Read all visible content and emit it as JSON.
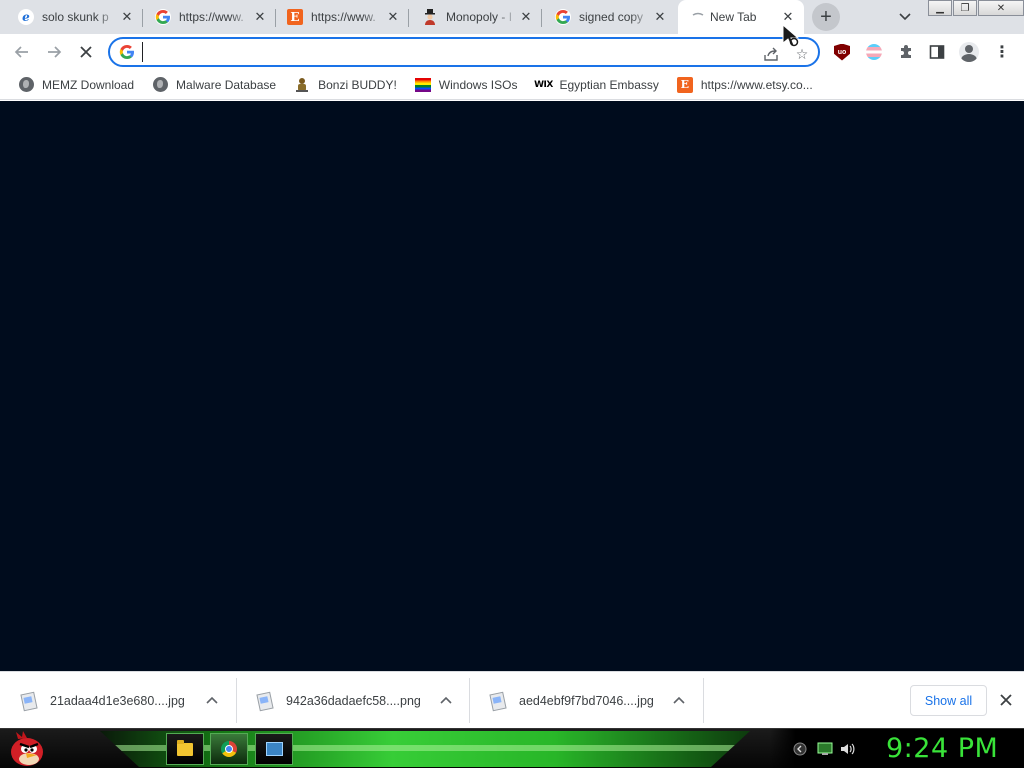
{
  "tabs": [
    {
      "title": "solo skunk p",
      "favicon": "e"
    },
    {
      "title": "https://www.",
      "favicon": "G"
    },
    {
      "title": "https://www.",
      "favicon": "E"
    },
    {
      "title": "Monopoly - I",
      "favicon": "monopoly"
    },
    {
      "title": "signed copy",
      "favicon": "G"
    },
    {
      "title": "New Tab",
      "favicon": "loading",
      "active": true
    }
  ],
  "toolbar": {
    "omnibox_value": "",
    "omnibox_search_glyph": "G"
  },
  "extensions": {
    "ublock_label": "uo"
  },
  "bookmarks": [
    {
      "label": "MEMZ Download",
      "icon": "globe-icon"
    },
    {
      "label": "Malware Database",
      "icon": "globe-icon"
    },
    {
      "label": "Bonzi BUDDY!",
      "icon": "bonzi-icon"
    },
    {
      "label": "Windows ISOs",
      "icon": "rainbow-flag-icon"
    },
    {
      "label": "Egyptian Embassy",
      "icon": "wix-icon",
      "icon_text": "WIX"
    },
    {
      "label": "https://www.etsy.co...",
      "icon": "etsy-icon",
      "icon_text": "E"
    }
  ],
  "downloads": {
    "items": [
      {
        "name": "21adaa4d1e3e680....jpg"
      },
      {
        "name": "942a36dadaefc58....png"
      },
      {
        "name": "aed4ebf9f7bd7046....jpg"
      }
    ],
    "show_all_label": "Show all"
  },
  "taskbar": {
    "clock": "9:24 PM"
  },
  "colors": {
    "content_background": "#000c1d",
    "accent": "#1a73e8",
    "clock": "#39e339"
  }
}
